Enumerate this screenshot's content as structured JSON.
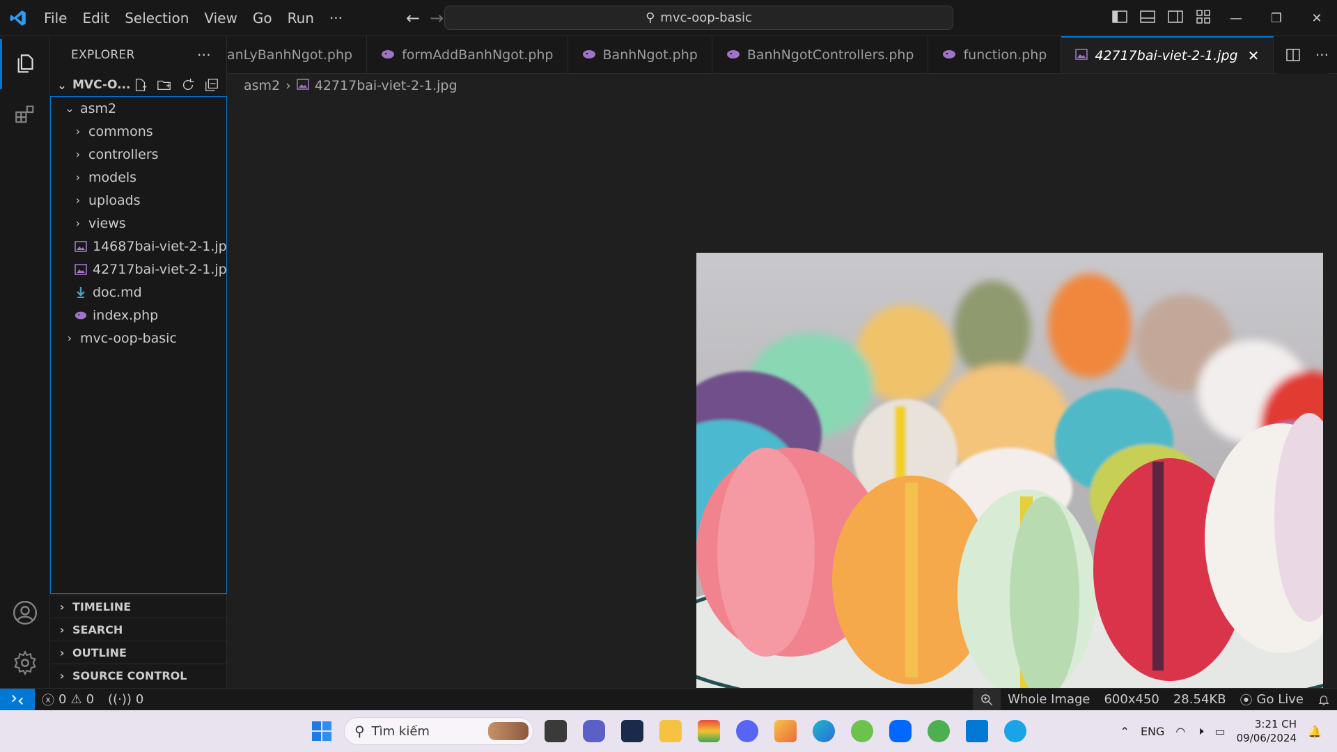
{
  "titlebar": {
    "menus": [
      "File",
      "Edit",
      "Selection",
      "View",
      "Go",
      "Run",
      "···"
    ],
    "command_center": "mvc-oop-basic"
  },
  "sidebar": {
    "title": "EXPLORER",
    "more": "···",
    "folder": "MVC-O...",
    "tree": [
      {
        "label": "asm2",
        "type": "folder-open",
        "indent": 1
      },
      {
        "label": "commons",
        "type": "folder",
        "indent": 2
      },
      {
        "label": "controllers",
        "type": "folder",
        "indent": 2
      },
      {
        "label": "models",
        "type": "folder",
        "indent": 2
      },
      {
        "label": "uploads",
        "type": "folder",
        "indent": 2
      },
      {
        "label": "views",
        "type": "folder",
        "indent": 2
      },
      {
        "label": "14687bai-viet-2-1.jpg",
        "type": "image",
        "indent": 2
      },
      {
        "label": "42717bai-viet-2-1.jpg",
        "type": "image",
        "indent": 2
      },
      {
        "label": "doc.md",
        "type": "markdown",
        "indent": 2
      },
      {
        "label": "index.php",
        "type": "php",
        "indent": 2
      },
      {
        "label": "mvc-oop-basic",
        "type": "folder",
        "indent": 1
      }
    ],
    "sections": [
      "TIMELINE",
      "SEARCH",
      "OUTLINE",
      "SOURCE CONTROL"
    ]
  },
  "tabs": [
    {
      "label": "anLyBanhNgot.php",
      "icon": "php-icon",
      "active": false,
      "partial": true
    },
    {
      "label": "formAddBanhNgot.php",
      "icon": "php-icon",
      "active": false
    },
    {
      "label": "BanhNgot.php",
      "icon": "php-icon",
      "active": false
    },
    {
      "label": "BanhNgotControllers.php",
      "icon": "php-icon",
      "active": false
    },
    {
      "label": "function.php",
      "icon": "php-icon",
      "active": false
    },
    {
      "label": "42717bai-viet-2-1.jpg",
      "icon": "image-icon",
      "active": true
    }
  ],
  "breadcrumb": {
    "folder": "asm2",
    "file": "42717bai-viet-2-1.jpg"
  },
  "statusbar": {
    "errors": "0",
    "warnings": "0",
    "ports": "0",
    "zoom_mode": "Whole Image",
    "dimensions": "600x450",
    "file_size": "28.54KB",
    "go_live": "Go Live"
  },
  "taskbar": {
    "search_placeholder": "Tìm kiếm",
    "language": "ENG",
    "time": "3:21 CH",
    "date": "09/06/2024"
  },
  "colors": {
    "accent": "#0078d4",
    "php_icon": "#a074c4",
    "image_icon": "#a074c4"
  }
}
